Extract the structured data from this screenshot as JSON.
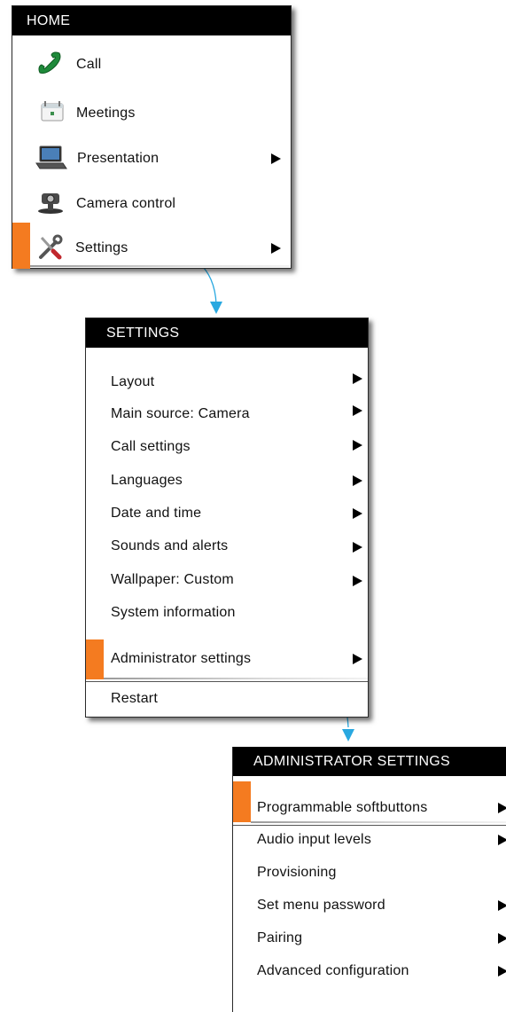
{
  "home": {
    "title": "HOME",
    "items": [
      {
        "label": "Call",
        "icon": "phone-icon"
      },
      {
        "label": "Meetings",
        "icon": "calendar-icon"
      },
      {
        "label": "Presentation",
        "icon": "laptop-icon"
      },
      {
        "label": "Camera control",
        "icon": "camera-icon"
      },
      {
        "label": "Settings",
        "icon": "tools-icon"
      }
    ]
  },
  "settings": {
    "title": "SETTINGS",
    "items": [
      {
        "label": "Layout"
      },
      {
        "label": "Main source: Camera"
      },
      {
        "label": "Call settings"
      },
      {
        "label": "Languages"
      },
      {
        "label": "Date and time"
      },
      {
        "label": "Sounds and alerts"
      },
      {
        "label": "Wallpaper: Custom"
      },
      {
        "label": "System information"
      },
      {
        "label": "Administrator settings"
      },
      {
        "label": "Restart"
      }
    ]
  },
  "admin": {
    "title": "ADMINISTRATOR SETTINGS",
    "items": [
      {
        "label": "Programmable softbuttons"
      },
      {
        "label": "Audio input levels"
      },
      {
        "label": "Provisioning"
      },
      {
        "label": "Set menu password"
      },
      {
        "label": "Pairing"
      },
      {
        "label": "Advanced configuration"
      }
    ]
  },
  "colors": {
    "selection": "#f47b20",
    "connector": "#29a8e0",
    "title_bar": "#000000"
  }
}
